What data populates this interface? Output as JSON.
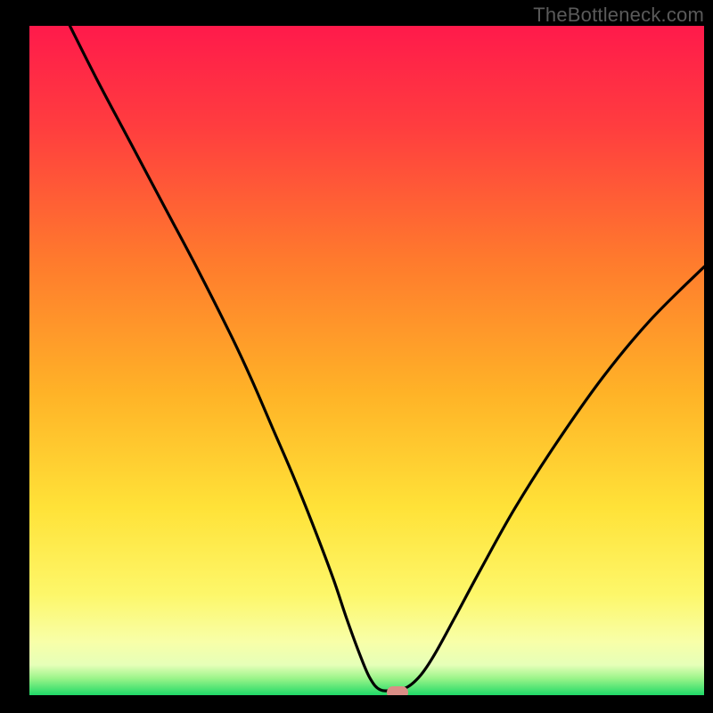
{
  "attribution": "TheBottleneck.com",
  "colors": {
    "gradient_stops": [
      {
        "offset": 0.0,
        "color": "#ff1a4b"
      },
      {
        "offset": 0.15,
        "color": "#ff3d3f"
      },
      {
        "offset": 0.35,
        "color": "#ff7a2d"
      },
      {
        "offset": 0.55,
        "color": "#ffb327"
      },
      {
        "offset": 0.72,
        "color": "#ffe238"
      },
      {
        "offset": 0.85,
        "color": "#fdf76a"
      },
      {
        "offset": 0.92,
        "color": "#f8ffa8"
      },
      {
        "offset": 0.955,
        "color": "#e6ffb8"
      },
      {
        "offset": 0.975,
        "color": "#9af489"
      },
      {
        "offset": 1.0,
        "color": "#1fd967"
      }
    ],
    "curve": "#000000",
    "marker": "#da8e86",
    "frame": "#000000"
  },
  "chart_data": {
    "type": "line",
    "title": "",
    "xlabel": "",
    "ylabel": "",
    "xlim": [
      0,
      100
    ],
    "ylim": [
      0,
      100
    ],
    "grid": false,
    "legend": false,
    "series": [
      {
        "name": "bottleneck-curve",
        "x": [
          6,
          10,
          15,
          20,
          25,
          30,
          33,
          36,
          39,
          42,
          45,
          47,
          49,
          50.5,
          52,
          54,
          56,
          58,
          60,
          63,
          67,
          72,
          78,
          85,
          92,
          100
        ],
        "y": [
          100,
          92,
          82.5,
          73,
          63.5,
          53.5,
          47,
          40,
          33,
          25.5,
          17.5,
          11.5,
          6,
          2.5,
          0.8,
          0.8,
          1.2,
          3,
          6,
          11.5,
          19,
          28,
          37.5,
          47.5,
          56,
          64
        ]
      }
    ],
    "marker": {
      "x": 54.5,
      "y": 0.4,
      "shape": "pill"
    }
  }
}
